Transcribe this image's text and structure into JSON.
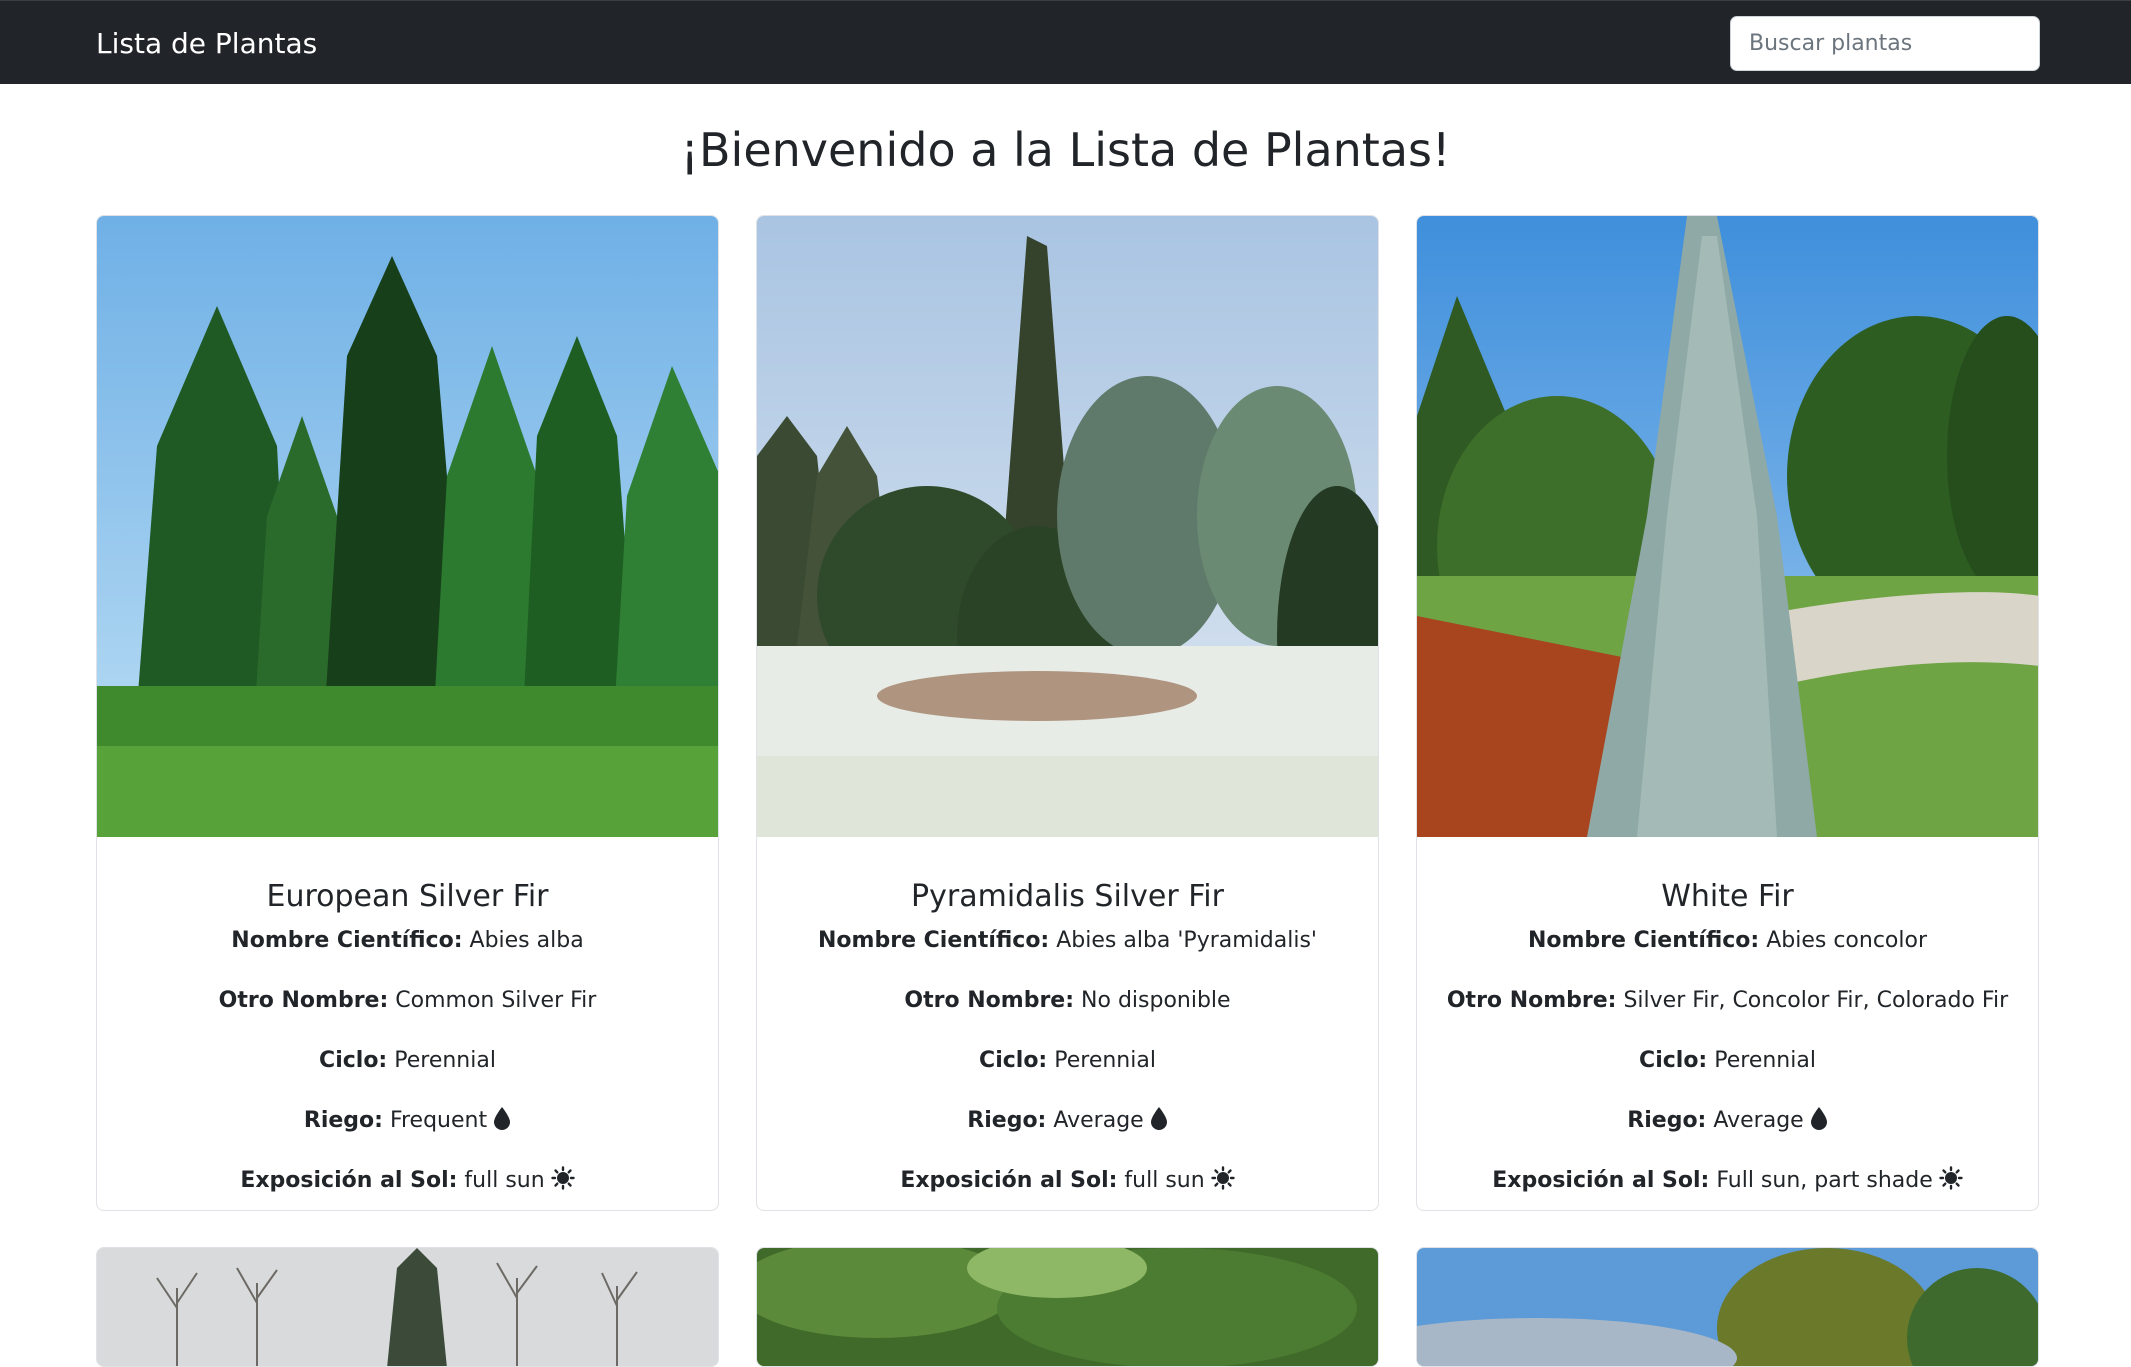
{
  "navbar": {
    "brand": "Lista de Plantas",
    "search_placeholder": "Buscar plantas"
  },
  "page": {
    "title": "¡Bienvenido a la Lista de Plantas!"
  },
  "labels": {
    "scientific": "Nombre Científico:",
    "other": "Otro Nombre:",
    "cycle": "Ciclo:",
    "watering": "Riego:",
    "sun": "Exposición al Sol:"
  },
  "icons": {
    "watering": "water-drop-icon",
    "sun": "sun-icon"
  },
  "plants": [
    {
      "name": "European Silver Fir",
      "scientific": "Abies alba",
      "other": "Common Silver Fir",
      "cycle": "Perennial",
      "watering": "Frequent",
      "sun": "full sun"
    },
    {
      "name": "Pyramidalis Silver Fir",
      "scientific": "Abies alba 'Pyramidalis'",
      "other": "No disponible",
      "cycle": "Perennial",
      "watering": "Average",
      "sun": "full sun"
    },
    {
      "name": "White Fir",
      "scientific": "Abies concolor",
      "other": "Silver Fir, Concolor Fir, Colorado Fir",
      "cycle": "Perennial",
      "watering": "Average",
      "sun": "Full sun, part shade"
    }
  ]
}
